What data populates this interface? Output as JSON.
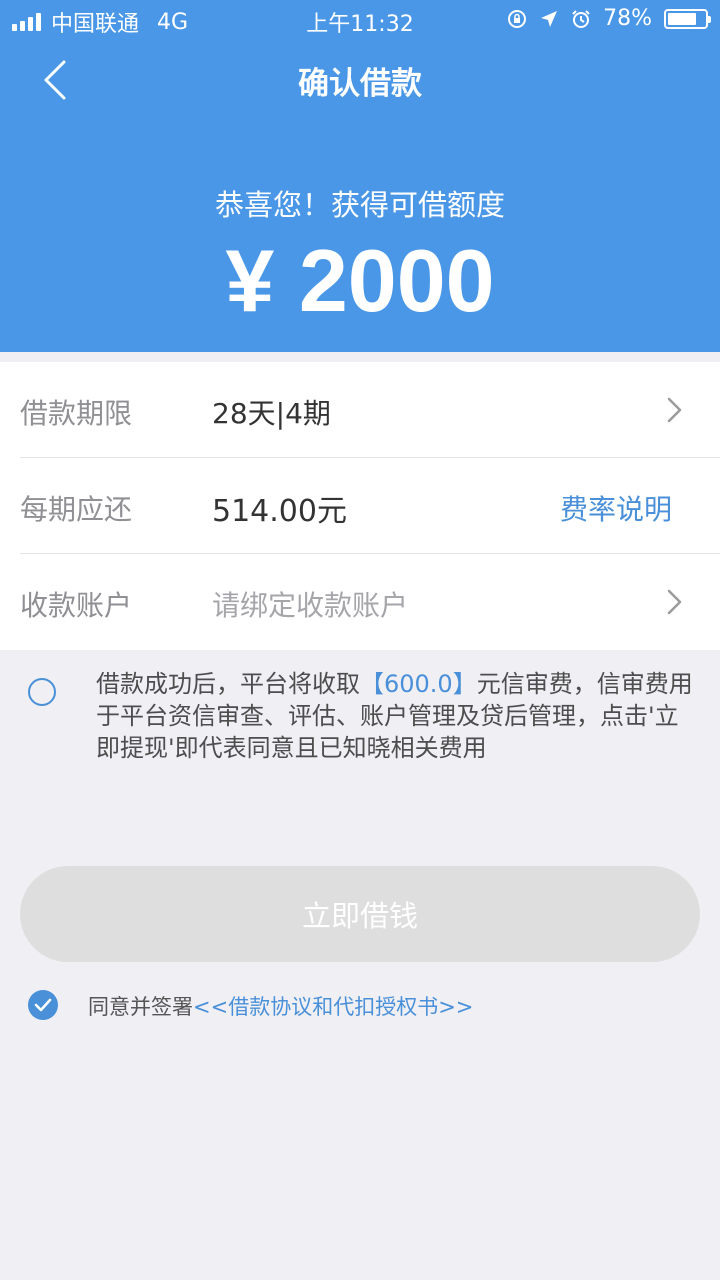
{
  "status_bar": {
    "carrier": "中国联通",
    "network": "4G",
    "time": "上午11:32",
    "battery_percent": "78%",
    "battery_level": 0.78
  },
  "nav": {
    "title": "确认借款",
    "back_icon": "chevron-left-icon"
  },
  "hero": {
    "subtitle": "恭喜您！获得可借额度",
    "amount": "¥ 2000"
  },
  "rows": [
    {
      "label": "借款期限",
      "value": "28天|4期",
      "icon": "chevron-right-icon"
    },
    {
      "label": "每期应还",
      "value": "514.00元",
      "link": "费率说明"
    },
    {
      "label": "收款账户",
      "placeholder": "请绑定收款账户",
      "icon": "chevron-right-icon"
    }
  ],
  "fee_notice": {
    "prefix": "借款成功后，平台将收取",
    "amount": "【600.0】",
    "suffix": "元信审费，信审费用于平台资信审查、评估、账户管理及贷后管理，点击'立即提现'即代表同意且已知晓相关费用"
  },
  "borrow_button": {
    "label": "立即借钱"
  },
  "agreement": {
    "prefix": "同意并签署",
    "link": "<<借款协议和代扣授权书>>"
  },
  "colors": {
    "primary": "#4a97e8",
    "link": "#4a90d9",
    "button_disabled": "#dedede",
    "background": "#efeff4"
  }
}
